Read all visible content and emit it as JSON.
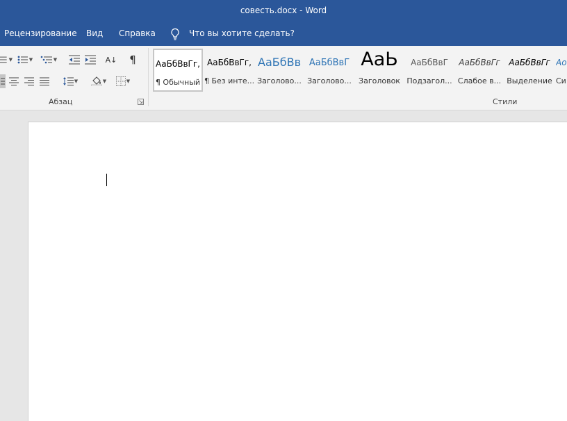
{
  "window": {
    "title": "совесть.docx  -  Word"
  },
  "tabs": [
    {
      "label": "Рецензирование"
    },
    {
      "label": "Вид"
    },
    {
      "label": "Справка"
    }
  ],
  "tell_me": {
    "label": "Что вы хотите сделать?",
    "icon": "lightbulb-icon"
  },
  "paragraph_group": {
    "label": "Абзац",
    "buttons": [
      {
        "name": "bullets",
        "icon": "bullet-list-icon"
      },
      {
        "name": "numbering",
        "icon": "numbered-list-icon"
      },
      {
        "name": "multilevel-list",
        "icon": "multilevel-list-icon"
      },
      {
        "name": "decrease-indent",
        "icon": "decrease-indent-icon"
      },
      {
        "name": "increase-indent",
        "icon": "increase-indent-icon"
      },
      {
        "name": "sort",
        "icon": "sort-az-icon"
      },
      {
        "name": "show-marks",
        "icon": "pilcrow-icon"
      },
      {
        "name": "align-left",
        "icon": "align-left-icon"
      },
      {
        "name": "align-center",
        "icon": "align-center-icon"
      },
      {
        "name": "align-right",
        "icon": "align-right-icon"
      },
      {
        "name": "justify",
        "icon": "justify-icon"
      },
      {
        "name": "line-spacing",
        "icon": "line-spacing-icon"
      },
      {
        "name": "shading",
        "icon": "paint-bucket-icon"
      },
      {
        "name": "borders",
        "icon": "borders-icon"
      }
    ],
    "sort_glyph": "A↓",
    "pilcrow_glyph": "¶"
  },
  "styles_group": {
    "label": "Стили",
    "items": [
      {
        "preview": "АаБбВвГг,",
        "name": "¶ Обычный",
        "selected": true,
        "color": "#000000"
      },
      {
        "preview": "АаБбВвГг,",
        "name": "¶ Без инте...",
        "selected": false,
        "color": "#000000"
      },
      {
        "preview": "АаБбВв",
        "name": "Заголово...",
        "selected": false,
        "color": "#2e74b5"
      },
      {
        "preview": "АаБбВвГ",
        "name": "Заголово...",
        "selected": false,
        "color": "#2e74b5"
      },
      {
        "preview": "АаЬ",
        "name": "Заголовок",
        "selected": false,
        "color": "#000000"
      },
      {
        "preview": "АаБбВвГ",
        "name": "Подзагол...",
        "selected": false,
        "color": "#595959"
      },
      {
        "preview": "АаБбВвГг",
        "name": "Слабое в...",
        "selected": false,
        "color": "#404040"
      },
      {
        "preview": "АаБбВвГг",
        "name": "Выделение",
        "selected": false,
        "color": "#000000"
      },
      {
        "preview": "Ao",
        "name": "Си",
        "selected": false,
        "color": "#2e74b5"
      }
    ]
  },
  "colors": {
    "brand": "#2b579a",
    "ribbon": "#f3f3f3",
    "canvas": "#e6e6e6"
  }
}
